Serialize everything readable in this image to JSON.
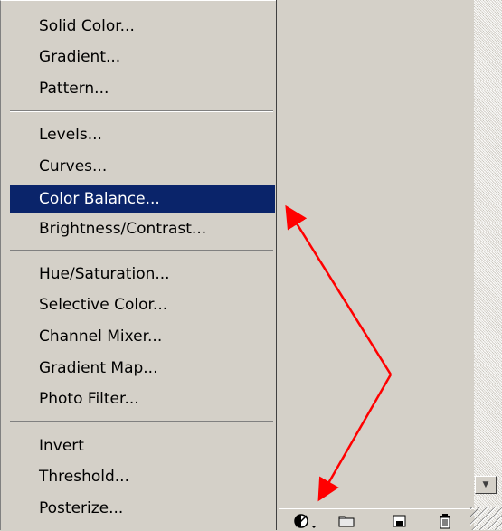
{
  "menu": {
    "groups": [
      [
        "Solid Color...",
        "Gradient...",
        "Pattern..."
      ],
      [
        "Levels...",
        "Curves...",
        "Color Balance...",
        "Brightness/Contrast..."
      ],
      [
        "Hue/Saturation...",
        "Selective Color...",
        "Channel Mixer...",
        "Gradient Map...",
        "Photo Filter..."
      ],
      [
        "Invert",
        "Threshold...",
        "Posterize..."
      ]
    ],
    "selected_item": "Color Balance..."
  },
  "toolbar": {
    "icons": [
      "adjustment-layer-icon",
      "folder-icon",
      "new-layer-icon",
      "trash-icon"
    ]
  },
  "colors": {
    "menu_bg": "#d4d0c8",
    "selection": "#0a246a",
    "annotation_arrow": "#ff0000"
  }
}
